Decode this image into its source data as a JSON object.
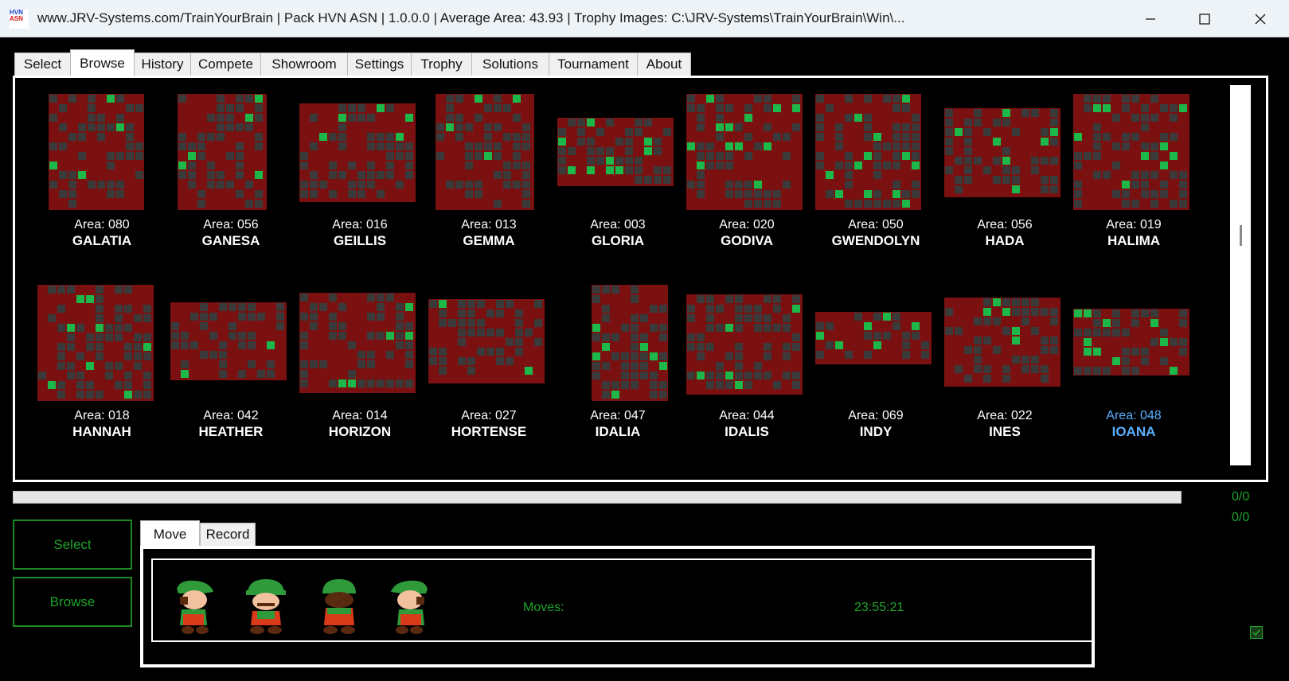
{
  "window": {
    "title": "www.JRV-Systems.com/TrainYourBrain | Pack HVN ASN | 1.0.0.0 | Average Area: 43.93 | Trophy Images: C:\\JRV-Systems\\TrainYourBrain\\Win\\...",
    "icon_text": [
      "HVN",
      "ASN"
    ],
    "controls": [
      "minimize-icon",
      "maximize-icon",
      "close-icon"
    ]
  },
  "tabs": [
    "Select",
    "Browse",
    "History",
    "Compete",
    "Showroom",
    "Settings",
    "Trophy",
    "Solutions",
    "Tournament",
    "About"
  ],
  "active_tab": "Browse",
  "puzzles": [
    {
      "area": "Area: 080",
      "name": "GALATIA"
    },
    {
      "area": "Area: 056",
      "name": "GANESA"
    },
    {
      "area": "Area: 016",
      "name": "GEILLIS"
    },
    {
      "area": "Area: 013",
      "name": "GEMMA"
    },
    {
      "area": "Area: 003",
      "name": "GLORIA"
    },
    {
      "area": "Area: 020",
      "name": "GODIVA"
    },
    {
      "area": "Area: 050",
      "name": "GWENDOLYN"
    },
    {
      "area": "Area: 056",
      "name": "HADA"
    },
    {
      "area": "Area: 019",
      "name": "HALIMA"
    },
    {
      "area": "Area: 018",
      "name": "HANNAH"
    },
    {
      "area": "Area: 042",
      "name": "HEATHER"
    },
    {
      "area": "Area: 014",
      "name": "HORIZON"
    },
    {
      "area": "Area: 027",
      "name": "HORTENSE"
    },
    {
      "area": "Area: 047",
      "name": "IDALIA"
    },
    {
      "area": "Area: 044",
      "name": "IDALIS"
    },
    {
      "area": "Area: 069",
      "name": "INDY"
    },
    {
      "area": "Area: 022",
      "name": "INES"
    },
    {
      "area": "Area: 048",
      "name": "IOANA"
    }
  ],
  "selected_puzzle": "IOANA",
  "counters": [
    "0/0",
    "0/0"
  ],
  "side_buttons": {
    "select": "Select",
    "browse": "Browse"
  },
  "bottom_tabs": [
    "Move",
    "Record"
  ],
  "status": {
    "moves_label": "Moves:",
    "time": "23:55:21"
  },
  "colors": {
    "wall": "#7a1010",
    "floor": "#3a3a3a",
    "goal": "#1db84a",
    "accent_text": "#1fa32b",
    "selected_text": "#5ab0ff"
  }
}
